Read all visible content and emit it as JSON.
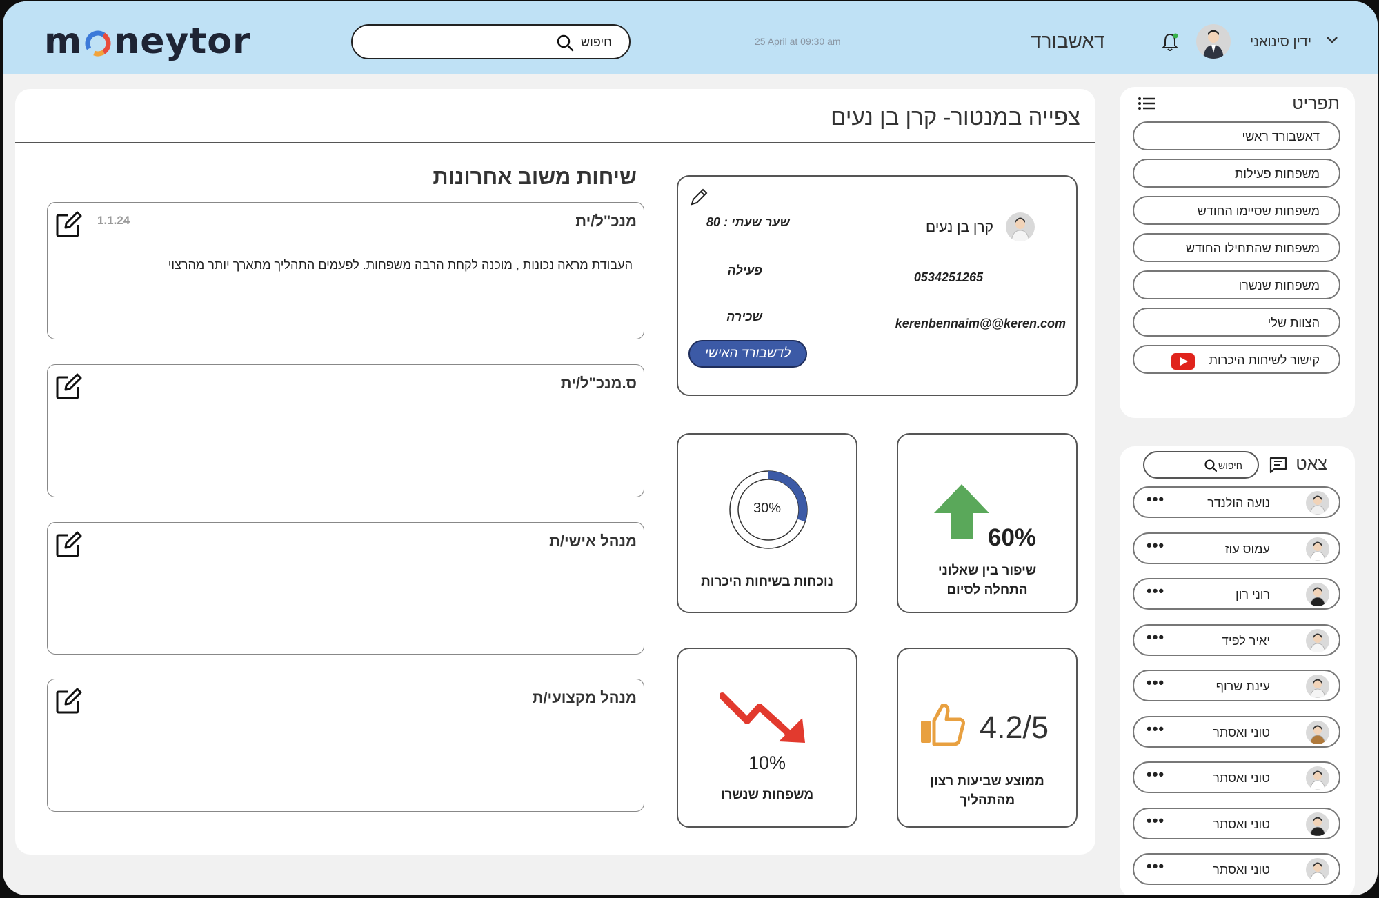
{
  "header": {
    "logo_pre": "m",
    "logo_post": "neytor",
    "search_placeholder": "חיפוש",
    "date": "25 April at 09:30 am",
    "dashboard": "דאשבורד",
    "user_name": "ידין סינואני"
  },
  "main": {
    "title": "צפייה במנטור- קרן בן נעים",
    "profile": {
      "name": "קרן בן נעים",
      "rate": "שער שעתי : 80",
      "phone": "0534251265",
      "status": "פעילה",
      "email": "kerenbennaim@@keren.com",
      "hire": "שכירה",
      "button": "לדשבורד האישי"
    },
    "stats": {
      "attendance_value": "30%",
      "attendance_fraction": 0.3,
      "attendance_label": "נוכחות בשיחות היכרות",
      "improvement_value": "60%",
      "improvement_label_1": "שיפור בין שאלוני",
      "improvement_label_2": "התחלה לסיום",
      "dropped_value": "10%",
      "dropped_label": "משפחות שנשרו",
      "satisfaction_value": "4.2/5",
      "satisfaction_label_1": "ממוצע שביעות רצון",
      "satisfaction_label_2": "מהתהליך"
    },
    "feedback": {
      "title": "שיחות משוב אחרונות",
      "items": [
        {
          "role": "מנכ\"ל/ית",
          "date": "1.1.24",
          "text": "העבודת מראה נכונות , מוכנה לקחת הרבה משפחות. לפעמים התהליך מתארך יותר מהרצוי"
        },
        {
          "role": "ס.מנכ\"ל/ית",
          "date": "",
          "text": ""
        },
        {
          "role": "מנהל אישי/ת",
          "date": "",
          "text": ""
        },
        {
          "role": "מנהל מקצועי/ת",
          "date": "",
          "text": ""
        }
      ]
    }
  },
  "menu": {
    "title": "תפריט",
    "items": [
      "דאשבורד ראשי",
      "משפחות פעילות",
      "משפחות שסיימו החודש",
      "משפחות שהתחילו החודש",
      "משפחות שנשרו",
      "הצוות שלי",
      "קישור לשיחות היכרות"
    ]
  },
  "chat": {
    "title": "צאט",
    "search_placeholder": "חיפוש",
    "contacts": [
      "נועה הולנדר",
      "עמוס עוז",
      "רוני רון",
      "יאיר לפיד",
      "עינת שרוף",
      "טוני ואסתר",
      "טוני ואסתר",
      "טוני ואסתר",
      "טוני ואסתר"
    ],
    "more_label": "•••"
  },
  "colors": {
    "topbar": "#bfe1f5",
    "accent_blue": "#3c5aa6",
    "up_green": "#5aa85a",
    "down_red": "#e23a2e",
    "thumb_orange": "#e8a040"
  }
}
